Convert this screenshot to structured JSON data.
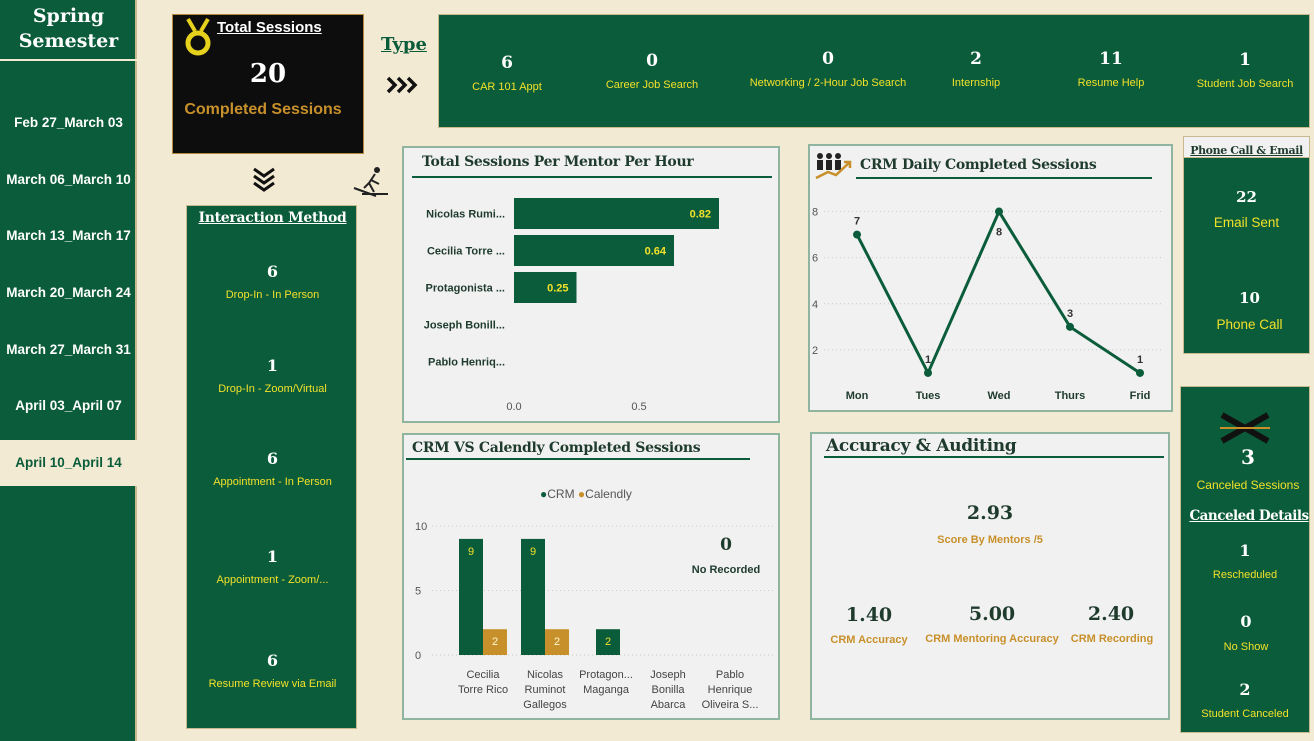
{
  "sidebar": {
    "title_line1": "Spring",
    "title_line2": "Semester",
    "weeks": [
      "Feb 27_March 03",
      "March 06_March 10",
      "March 13_March 17",
      "March 20_March 24",
      "March 27_March 31",
      "April 03_April 07",
      "April 10_April 14"
    ],
    "active_week": "April 10_April 14"
  },
  "total_sessions": {
    "heading": "Total Sessions",
    "value": "20",
    "label": "Completed Sessions",
    "icon": "medal-icon"
  },
  "type": {
    "heading": "Type",
    "items": [
      {
        "value": "6",
        "label": "CAR 101 Appt"
      },
      {
        "value": "0",
        "label": "Career Job Search"
      },
      {
        "value": "0",
        "label": "Networking / 2-Hour Job Search"
      },
      {
        "value": "2",
        "label": "Internship"
      },
      {
        "value": "11",
        "label": "Resume Help"
      },
      {
        "value": "1",
        "label": "Student Job Search"
      }
    ]
  },
  "interaction_method": {
    "heading": "Interaction Method",
    "items": [
      {
        "value": "6",
        "label": "Drop-In - In Person"
      },
      {
        "value": "1",
        "label": "Drop-In - Zoom/Virtual"
      },
      {
        "value": "6",
        "label": "Appointment - In Person"
      },
      {
        "value": "1",
        "label": "Appointment - Zoom/..."
      },
      {
        "value": "6",
        "label": "Resume Review via Email"
      }
    ]
  },
  "mentor_chart": {
    "title": "Total Sessions Per Mentor Per Hour",
    "labels": [
      "Nicolas Rumi...",
      "Cecilia Torre ...",
      "Protagonista ...",
      "Joseph Bonill...",
      "Pablo Henriq..."
    ]
  },
  "daily_chart": {
    "title": "CRM Daily Completed Sessions"
  },
  "crm_calendly": {
    "title": "CRM VS  Calendly Completed Sessions",
    "legend": [
      "CRM",
      "Calendly"
    ],
    "no_recorded_value": "0",
    "no_recorded_label": "No Recorded",
    "category_lines": [
      [
        "Cecilia",
        "Torre Rico"
      ],
      [
        "Nicolas",
        "Ruminot",
        "Gallegos"
      ],
      [
        "Protagon...",
        "Maganga"
      ],
      [
        "Joseph",
        "Bonilla",
        "Abarca"
      ],
      [
        "Pablo",
        "Henrique",
        "Oliveira S..."
      ]
    ]
  },
  "accuracy": {
    "title": "Accuracy & Auditing",
    "score_value": "2.93",
    "score_label": "Score By Mentors /5",
    "metrics": [
      {
        "value": "1.40",
        "label": "CRM Accuracy"
      },
      {
        "value": "5.00",
        "label": "CRM Mentoring Accuracy"
      },
      {
        "value": "2.40",
        "label": "CRM Recording"
      }
    ]
  },
  "phone_email": {
    "heading": "Phone Call & Email",
    "email_value": "22",
    "email_label": "Email Sent",
    "phone_value": "10",
    "phone_label": "Phone Call"
  },
  "canceled": {
    "value": "3",
    "label": "Canceled Sessions",
    "details_heading": "Canceled Details",
    "items": [
      {
        "value": "1",
        "label": "Rescheduled"
      },
      {
        "value": "0",
        "label": "No Show"
      },
      {
        "value": "2",
        "label": "Student Canceled"
      }
    ]
  },
  "colors": {
    "green": "#0b5c3a",
    "gold": "#c8902a",
    "yellow": "#f2e12a",
    "background": "#f3ead3"
  },
  "chart_data": [
    {
      "type": "bar",
      "title": "Total Sessions Per Mentor Per Hour",
      "orientation": "horizontal",
      "categories": [
        "Nicolas Rumi...",
        "Cecilia Torre ...",
        "Protagonista ...",
        "Joseph Bonill...",
        "Pablo Henriq..."
      ],
      "values": [
        0.82,
        0.64,
        0.25,
        0,
        0
      ],
      "xticks": [
        "0.0",
        "0.5"
      ],
      "xlim": [
        0,
        1.0
      ]
    },
    {
      "type": "line",
      "title": "CRM Daily Completed Sessions",
      "x": [
        "Mon",
        "Tues",
        "Wed",
        "Thurs",
        "Frid"
      ],
      "values": [
        7,
        1,
        8,
        3,
        1
      ],
      "yticks": [
        2,
        4,
        6,
        8
      ],
      "ylim": [
        0,
        8.5
      ]
    },
    {
      "type": "bar",
      "title": "CRM VS  Calendly Completed Sessions",
      "categories": [
        "Cecilia Torre Rico",
        "Nicolas Ruminot Gallegos",
        "Protagon... Maganga",
        "Joseph Bonilla Abarca",
        "Pablo Henrique Oliveira S..."
      ],
      "series": [
        {
          "name": "CRM",
          "values": [
            9,
            9,
            2,
            null,
            null
          ]
        },
        {
          "name": "Calendly",
          "values": [
            2,
            2,
            null,
            null,
            null
          ]
        }
      ],
      "yticks": [
        0,
        5,
        10
      ],
      "ylim": [
        0,
        10
      ]
    }
  ]
}
